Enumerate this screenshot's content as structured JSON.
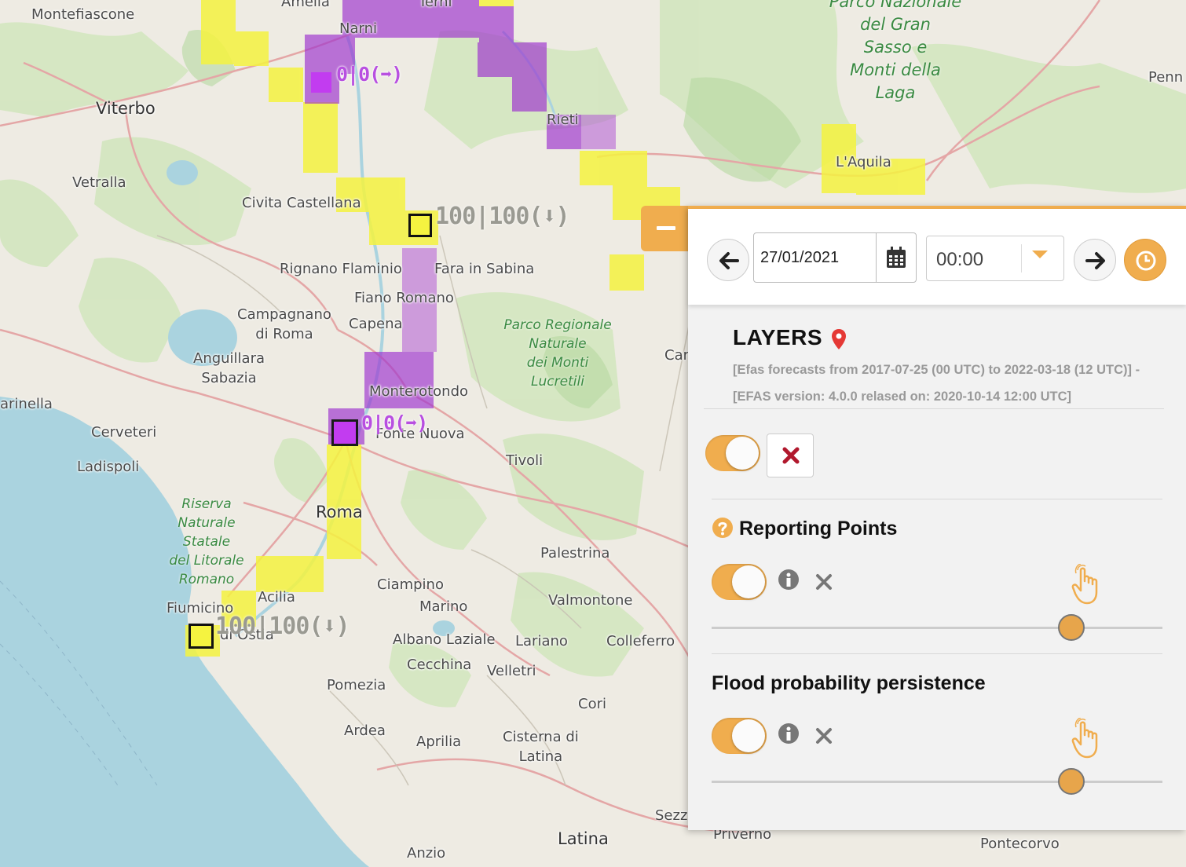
{
  "map": {
    "places": [
      {
        "id": "montefiascone",
        "name": "Montefiascone"
      },
      {
        "id": "amelia",
        "name": "Amelia"
      },
      {
        "id": "narni",
        "name": "Narni"
      },
      {
        "id": "terni",
        "name": "Terni"
      },
      {
        "id": "viterbo",
        "name": "Viterbo"
      },
      {
        "id": "rieti",
        "name": "Rieti"
      },
      {
        "id": "vetralla",
        "name": "Vetralla"
      },
      {
        "id": "civita",
        "name": "Civita Castellana"
      },
      {
        "id": "laquila",
        "name": "L'Aquila"
      },
      {
        "id": "penne",
        "name": "Penn"
      },
      {
        "id": "rignano",
        "name": "Rignano Flaminio"
      },
      {
        "id": "fara",
        "name": "Fara in Sabina"
      },
      {
        "id": "fiano",
        "name": "Fiano Romano"
      },
      {
        "id": "campagnano",
        "name": "Campagnano\ndi Roma"
      },
      {
        "id": "capena",
        "name": "Capena"
      },
      {
        "id": "anguillara",
        "name": "Anguillara\nSabazia"
      },
      {
        "id": "car",
        "name": "Car"
      },
      {
        "id": "monterotondo",
        "name": "Monterotondo"
      },
      {
        "id": "marinella",
        "name": "arinella"
      },
      {
        "id": "cerveteri",
        "name": "Cerveteri"
      },
      {
        "id": "fonte",
        "name": "Fonte Nuova"
      },
      {
        "id": "ladispoli",
        "name": "Ladispoli"
      },
      {
        "id": "tivoli",
        "name": "Tivoli"
      },
      {
        "id": "roma",
        "name": "Roma"
      },
      {
        "id": "palestrina",
        "name": "Palestrina"
      },
      {
        "id": "ciampino",
        "name": "Ciampino"
      },
      {
        "id": "acilia",
        "name": "Acilia"
      },
      {
        "id": "valmontone",
        "name": "Valmontone"
      },
      {
        "id": "marino",
        "name": "Marino"
      },
      {
        "id": "fiumicino",
        "name": "Fiumicino"
      },
      {
        "id": "albano",
        "name": "Albano Laziale"
      },
      {
        "id": "lariano",
        "name": "Lariano"
      },
      {
        "id": "colleferro",
        "name": "Colleferro"
      },
      {
        "id": "ostia",
        "name": "di Ostia"
      },
      {
        "id": "cecchina",
        "name": "Cecchina"
      },
      {
        "id": "velletri",
        "name": "Velletri"
      },
      {
        "id": "pomezia",
        "name": "Pomezia"
      },
      {
        "id": "cori",
        "name": "Cori"
      },
      {
        "id": "ardea",
        "name": "Ardea"
      },
      {
        "id": "aprilia",
        "name": "Aprilia"
      },
      {
        "id": "cisterna",
        "name": "Cisterna di\nLatina"
      },
      {
        "id": "sezze",
        "name": "Sezz"
      },
      {
        "id": "priverno",
        "name": "Priverno"
      },
      {
        "id": "latina",
        "name": "Latina"
      },
      {
        "id": "pontecorvo",
        "name": "Pontecorvo"
      },
      {
        "id": "anzio",
        "name": "Anzio"
      }
    ],
    "parks": [
      {
        "id": "gransasso",
        "name": "Parco Nazionale\ndel Gran\nSasso e\nMonti della\nLaga"
      },
      {
        "id": "lucretili",
        "name": "Parco Regionale\nNaturale\ndei Monti\nLucretili"
      },
      {
        "id": "litorale",
        "name": "Riserva\nNaturale\nStatale\ndel Litorale\nRomano"
      }
    ],
    "reporting_points": [
      {
        "id": "rp1",
        "label": "0|0(➡)",
        "color": "purple"
      },
      {
        "id": "rp2",
        "label": "100|100(⬇)",
        "color": "yellow"
      },
      {
        "id": "rp3",
        "label": "0|0(➡)",
        "color": "purple"
      },
      {
        "id": "rp4",
        "label": "100|100(⬇)",
        "color": "yellow"
      }
    ],
    "colors": {
      "yellow": "#f5f340",
      "purple": "#9a2ccc",
      "water": "#aad3df"
    }
  },
  "panel": {
    "collapse_icon": "minus-icon",
    "time": {
      "prev_icon": "arrow-left-icon",
      "date_value": "27/01/2021",
      "calendar_icon": "calendar-icon",
      "time_value": "00:00",
      "dropdown_icon": "caret-down-icon",
      "next_icon": "arrow-right-icon",
      "clock_icon": "clock-icon"
    },
    "layers_title": "LAYERS",
    "pin_icon": "map-pin-icon",
    "efas_info": "[Efas forecasts from 2017-07-25 (00 UTC) to 2022-03-18 (12 UTC)] - [EFAS version: 4.0.0 relased on: 2020-10-14 12:00 UTC]",
    "master_toggle_on": true,
    "sections": [
      {
        "id": "reporting",
        "title": "Reporting Points",
        "help_icon": "question-icon",
        "toggle_on": true,
        "opacity": 0.8
      },
      {
        "id": "persistence",
        "title": "Flood probability persistence",
        "toggle_on": true,
        "opacity": 0.8
      }
    ],
    "accent": "#f0ad4e"
  }
}
